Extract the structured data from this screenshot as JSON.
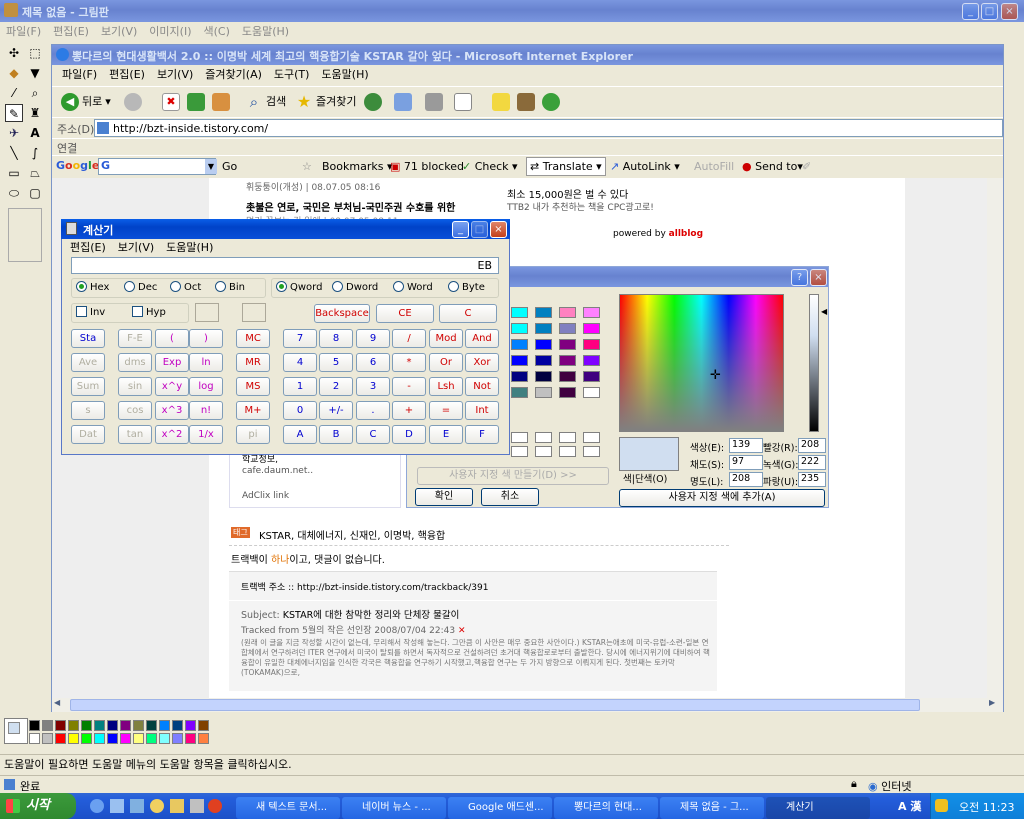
{
  "paint": {
    "title": "제목 없음 - 그림판",
    "menu": [
      "파일(F)",
      "편집(E)",
      "보기(V)",
      "이미지(I)",
      "색(C)",
      "도움말(H)"
    ],
    "status": "도움말이 필요하면 도움말 메뉴의 도움말 항목을 클릭하십시오.",
    "palette": [
      "#000000",
      "#808080",
      "#800000",
      "#808000",
      "#008000",
      "#008080",
      "#000080",
      "#800080",
      "#808040",
      "#004040",
      "#0080ff",
      "#004080",
      "#8000ff",
      "#804000",
      "#ffffff",
      "#c0c0c0",
      "#ff0000",
      "#ffff00",
      "#00ff00",
      "#00ffff",
      "#0000ff",
      "#ff00ff",
      "#ffff80",
      "#00ff80",
      "#80ffff",
      "#8080ff",
      "#ff0080",
      "#ff8040"
    ]
  },
  "ie": {
    "title": "뽕다르의 현대생활백서 2.0 :: 이명박 세계 최고의 핵융합기술 KSTAR 갈아 엎다 - Microsoft Internet Explorer",
    "menu": [
      "파일(F)",
      "편집(E)",
      "보기(V)",
      "즐겨찾기(A)",
      "도구(T)",
      "도움말(H)"
    ],
    "back": "뒤로",
    "search": "검색",
    "favorites": "즐겨찾기",
    "address_label": "주소(D)",
    "address": "http://bzt-inside.tistory.com/",
    "links": "연결",
    "google": {
      "go": "Go",
      "bookmarks": "Bookmarks",
      "blocked": "71 blocked",
      "check": "Check",
      "translate": "Translate",
      "autolink": "AutoLink",
      "autofill": "AutoFill",
      "sendto": "Send to"
    },
    "status_left": "완료",
    "status_right": "인터넷"
  },
  "page": {
    "meta1": "휘둥퉁이(개성) | 08.07.05 08:16",
    "post_title": "촛불은 연로, 국민은 부처님-국민주권 수호를 위한",
    "post_sub": "멀리 꽃보는 긴 일에 | 08.07.05 08:11",
    "ad1": "최소 15,000원은 벌 수 있다",
    "ad2": "TTB2 내가 추천하는 책을 CPC광고로!",
    "powered": "powered by",
    "allblog": "allblog",
    "daum1": "학교정보,",
    "daum2": "cafe.daum.net..",
    "adclix": "AdClix link",
    "tag_label": "태그",
    "tags": "KSTAR, 대체에너지, 신재인, 이명박, 핵융합",
    "trackback_line_a": "트랙백이 ",
    "trackback_count": "하나",
    "trackback_line_b": "이고, 댓글이 없습니다.",
    "trackback_addr": "트랙백 주소 :: http://bzt-inside.tistory.com/trackback/391",
    "subject_label": "Subject:",
    "subject": "KSTAR에 대한 참막한 정리와 단체장 물갈이",
    "tracked": "Tracked from 5월의 작은 선인장 2008/07/04 22:43",
    "body": "(원래 이 글을 지금 작성할 시간이 없는데, 무리해서 작성해 놓는다. 그만큼 이 사안은 매우 중요한 사안이다.) KSTAR는애초에 미국-유럽-소련-일본 연합체에서 연구하려던 ITER 연구에서 미국이 탈퇴를 하면서 독자적으로 건설하려던 초거대 핵융합로로부터 출발한다. 당시에 에너지위기에 대비하여 핵융합이 유일한 대체에너지임을 인식한 각국은 핵융합을 연구하기 시작했고,핵융합 연구는 두 가지 방향으로 이뤄지게 된다. 첫번째는 토카막(TOKAMAK)으로,"
  },
  "calc": {
    "title": "계산기",
    "menu": [
      "편집(E)",
      "보기(V)",
      "도움말(H)"
    ],
    "display": "EB",
    "bases": [
      "Hex",
      "Dec",
      "Oct",
      "Bin"
    ],
    "words": [
      "Qword",
      "Dword",
      "Word",
      "Byte"
    ],
    "inv": "Inv",
    "hyp": "Hyp",
    "backspace": "Backspace",
    "ce": "CE",
    "c": "C",
    "sci": [
      [
        "Sta",
        "F-E",
        "(",
        ")"
      ],
      [
        "Ave",
        "dms",
        "Exp",
        "ln"
      ],
      [
        "Sum",
        "sin",
        "x^y",
        "log"
      ],
      [
        "s",
        "cos",
        "x^3",
        "n!"
      ],
      [
        "Dat",
        "tan",
        "x^2",
        "1/x"
      ]
    ],
    "mem": [
      "MC",
      "MR",
      "MS",
      "M+",
      "pi"
    ],
    "nums": [
      [
        "7",
        "8",
        "9",
        "/",
        "Mod",
        "And"
      ],
      [
        "4",
        "5",
        "6",
        "*",
        "Or",
        "Xor"
      ],
      [
        "1",
        "2",
        "3",
        "-",
        "Lsh",
        "Not"
      ],
      [
        "0",
        "+/-",
        ".",
        "+",
        "=",
        "Int"
      ],
      [
        "A",
        "B",
        "C",
        "D",
        "E",
        "F"
      ]
    ]
  },
  "colordlg": {
    "custom_btn": "사용자 지정 색 만들기(D) >>",
    "ok": "확인",
    "cancel": "취소",
    "solid": "색|단색(O)",
    "hue_label": "색상(E):",
    "hue": "139",
    "sat_label": "채도(S):",
    "sat": "97",
    "lum_label": "명도(L):",
    "lum": "208",
    "red_label": "빨강(R):",
    "red": "208",
    "green_label": "녹색(G):",
    "green": "222",
    "blue_label": "파랑(U):",
    "blue": "235",
    "add": "사용자 지정 색에 추가(A)",
    "basic": [
      "#00ffff",
      "#0080c0",
      "#ff80c0",
      "#ff80ff",
      "#00ffff",
      "#0080c0",
      "#8080c0",
      "#ff00ff",
      "#0080ff",
      "#0000ff",
      "#800080",
      "#ff0080",
      "#0000ff",
      "#0000a0",
      "#800080",
      "#8000ff",
      "#000080",
      "#000040",
      "#400040",
      "#400080",
      "#408080",
      "#c0c0c0",
      "#400040",
      "#ffffff"
    ]
  },
  "taskbar": {
    "start": "시작",
    "tasks": [
      "새 텍스트 문서...",
      "네이버 뉴스 - ...",
      "Google 애드센...",
      "뽕다르의 현대...",
      "제목 없음 - 그...",
      "계산기"
    ],
    "lang": "A 漢",
    "time": "오전 11:23"
  }
}
